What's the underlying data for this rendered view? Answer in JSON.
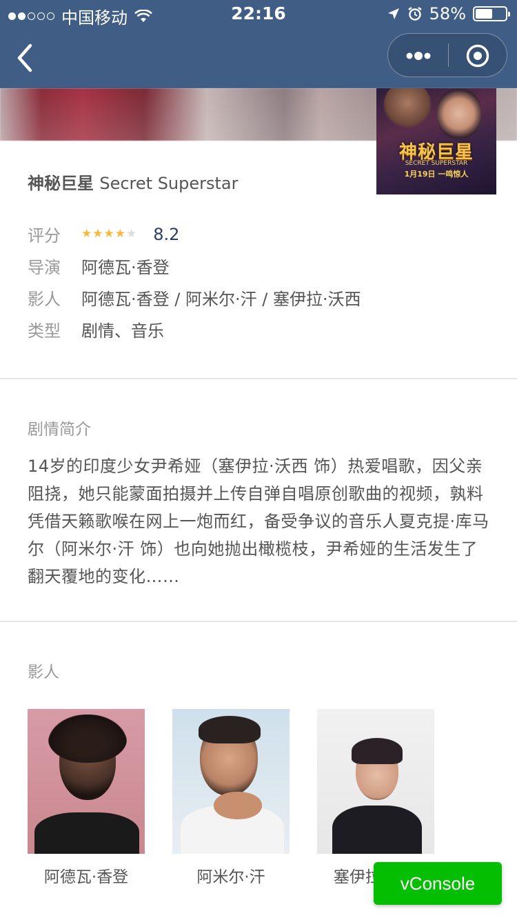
{
  "status_bar": {
    "carrier": "中国移动",
    "time": "22:16",
    "battery_percent": "58%",
    "battery_level": 0.58
  },
  "movie": {
    "title_cn": "神秘巨星",
    "title_en": "Secret Superstar",
    "poster": {
      "title": "神秘巨星",
      "subtitle": "SECRET SUPERSTAR",
      "date": "1月19日 一鸣惊人"
    },
    "rating_label": "评分",
    "rating_stars": 4,
    "rating_max_stars": 5,
    "score": "8.2",
    "director_label": "导演",
    "director": "阿德瓦·香登",
    "cast_label": "影人",
    "cast_line": "阿德瓦·香登 / 阿米尔·汗 / 塞伊拉·沃西",
    "genre_label": "类型",
    "genre": "剧情、音乐"
  },
  "synopsis": {
    "heading": "剧情简介",
    "text": "14岁的印度少女尹希娅（塞伊拉·沃西 饰）热爱唱歌，因父亲阻挠，她只能蒙面拍摄并上传自弹自唱原创歌曲的视频，孰料凭借天籁歌喉在网上一炮而红，备受争议的音乐人夏克提·库马尔（阿米尔·汗 饰）也向她抛出橄榄枝，尹希娅的生活发生了翻天覆地的变化……"
  },
  "cast": {
    "heading": "影人",
    "people": [
      {
        "name": "阿德瓦·香登"
      },
      {
        "name": "阿米尔·汗"
      },
      {
        "name": "塞伊拉·沃西"
      }
    ]
  },
  "vconsole": {
    "label": "vConsole"
  },
  "colors": {
    "nav_bg": "#3f5d85",
    "star": "#f6b93b",
    "score": "#2b3e6b",
    "vconsole": "#04be02"
  }
}
